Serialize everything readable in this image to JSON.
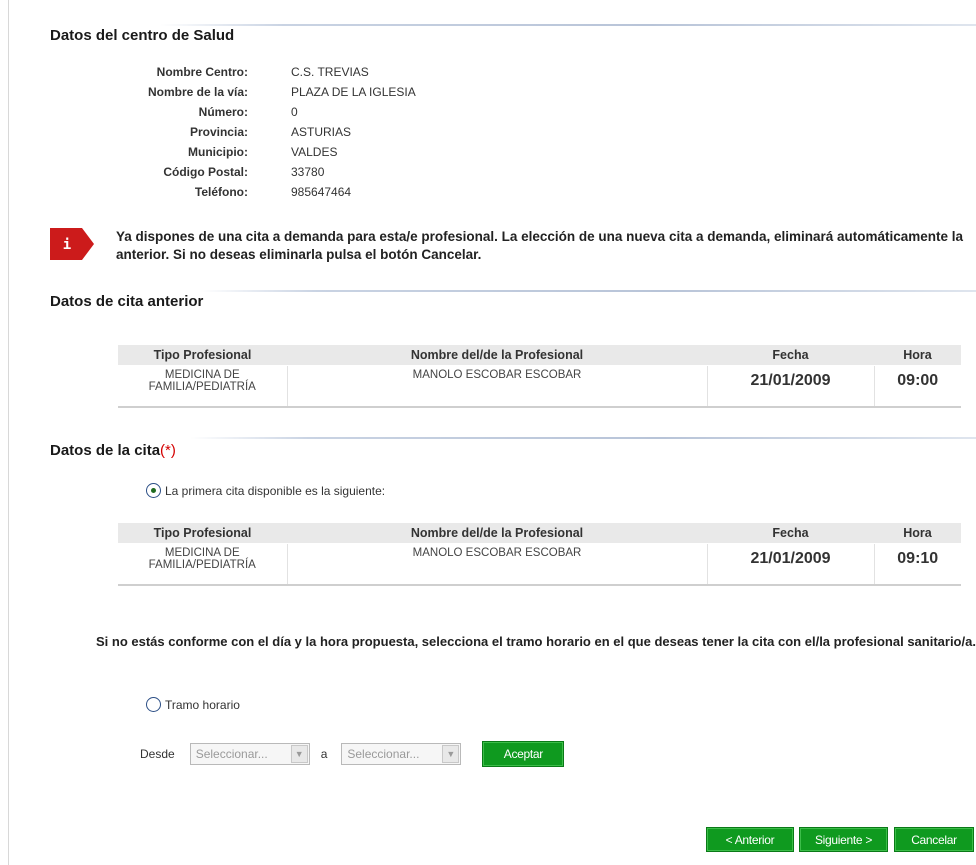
{
  "centro": {
    "title": "Datos del centro de Salud",
    "fields": [
      {
        "label": "Nombre Centro:",
        "value": "C.S. TREVIAS"
      },
      {
        "label": "Nombre de la vía:",
        "value": "PLAZA DE LA IGLESIA"
      },
      {
        "label": "Número:",
        "value": "0"
      },
      {
        "label": "Provincia:",
        "value": "ASTURIAS"
      },
      {
        "label": "Municipio:",
        "value": "VALDES"
      },
      {
        "label": "Código Postal:",
        "value": "33780"
      },
      {
        "label": "Teléfono:",
        "value": "985647464"
      }
    ]
  },
  "info": {
    "icon": "i",
    "message": "Ya dispones de una cita a demanda para esta/e profesional. La elección de una nueva cita a demanda, eliminará automáticamente la anterior. Si no deseas eliminarla pulsa el botón Cancelar."
  },
  "cita_anterior": {
    "title": "Datos de cita anterior",
    "headers": [
      "Tipo Profesional",
      "Nombre del/de la Profesional",
      "Fecha",
      "Hora"
    ],
    "row": {
      "tipo": "MEDICINA DE FAMILIA/PEDIATRÍA",
      "nombre": "MANOLO ESCOBAR ESCOBAR",
      "fecha": "21/01/2009",
      "hora": "09:00"
    }
  },
  "cita": {
    "title": "Datos de la cita",
    "required_mark": "(*)",
    "primera_label": "La primera cita disponible es la siguiente:",
    "headers": [
      "Tipo Profesional",
      "Nombre del/de la Profesional",
      "Fecha",
      "Hora"
    ],
    "row": {
      "tipo": "MEDICINA DE FAMILIA/PEDIATRÍA",
      "nombre": "MANOLO ESCOBAR ESCOBAR",
      "fecha": "21/01/2009",
      "hora": "09:10"
    },
    "conforme_text": "Si no estás conforme con el día y la hora propuesta, selecciona el tramo horario en el que deseas tener la cita con el/la profesional sanitario/a.",
    "tramo_label": "Tramo horario",
    "desde_label": "Desde",
    "a_label": "a",
    "desde_select": "Seleccionar...",
    "hasta_select": "Seleccionar...",
    "aceptar": "Aceptar"
  },
  "nav": {
    "anterior": "< Anterior",
    "siguiente": "Siguiente >",
    "cancelar": "Cancelar"
  },
  "colors": {
    "accent_green": "#0f9a1f",
    "info_red": "#cc1b1b",
    "required_red": "#d40000"
  }
}
